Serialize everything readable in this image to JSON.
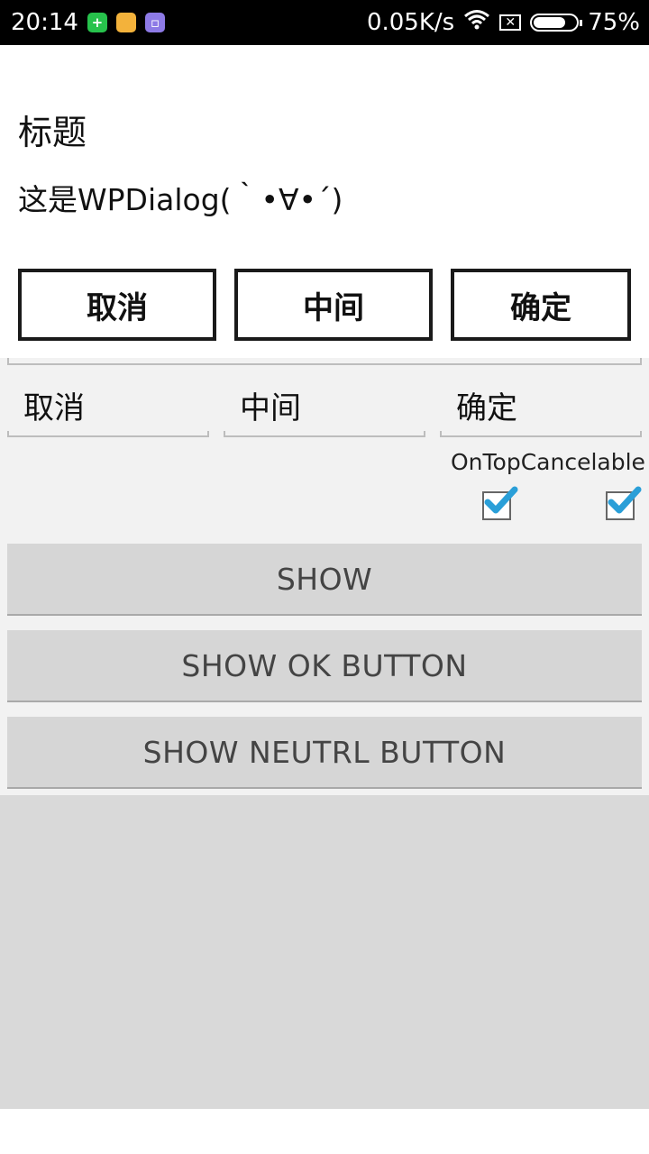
{
  "status_bar": {
    "time": "20:14",
    "net_speed": "0.05K/s",
    "battery_percent": "75%",
    "battery_level": 0.75,
    "icons": [
      "app-green-icon",
      "app-yellow-icon",
      "app-purple-icon",
      "wifi-icon",
      "no-sim-icon",
      "battery-icon"
    ]
  },
  "dialog": {
    "title": "标题",
    "message": "这是WPDialog(｀•∀•´)",
    "buttons": {
      "cancel": "取消",
      "neutral": "中间",
      "ok": "确定"
    }
  },
  "form": {
    "cancel_field": "取消",
    "neutral_field": "中间",
    "ok_field": "确定",
    "checkbox_label": "OnTopCancelable",
    "ontop_checked": true,
    "cancelable_checked": true
  },
  "actions": {
    "show": "SHOW",
    "show_ok": "SHOW OK BUTTON",
    "show_neutral": "SHOW NEUTRL BUTTON"
  },
  "colors": {
    "check_blue": "#2a9fd8",
    "button_gray": "#d6d6d6",
    "form_bg": "#f2f2f2",
    "bottom_bg": "#d9d9d9"
  }
}
